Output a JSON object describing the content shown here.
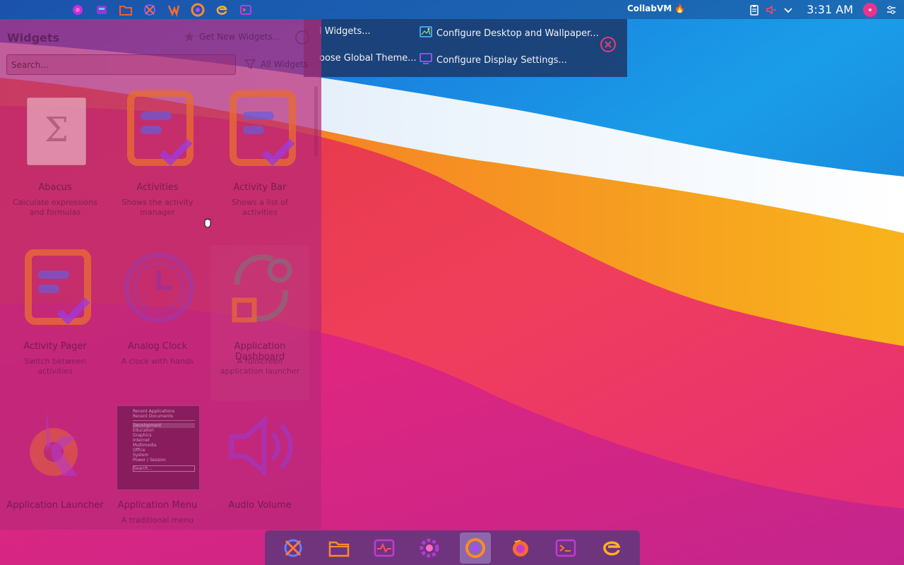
{
  "top_panel": {
    "title": "CollabVM",
    "title_suffix": "🔥",
    "clock": "3:31 AM",
    "launchers": [
      "settings-gear-icon",
      "network-icon",
      "folder-icon",
      "crossed-globe-icon",
      "flame-browser-icon",
      "chrome-icon",
      "edge-icon",
      "terminal-icon"
    ],
    "tray": [
      "clipboard-icon",
      "volume-muted-icon",
      "chevron-down-icon"
    ]
  },
  "toolbox": {
    "items": [
      {
        "label": "l Widgets...",
        "icon": "none"
      },
      {
        "label": "Configure Desktop and Wallpaper...",
        "icon": "wallpaper-icon"
      },
      {
        "label": "oose Global Theme...",
        "icon": "none"
      },
      {
        "label": "Configure Display Settings...",
        "icon": "monitor-icon"
      }
    ]
  },
  "widgets": {
    "title": "Widgets",
    "get_new": "Get New Widgets...",
    "search_placeholder": "Search...",
    "filter": "All Widgets",
    "items": [
      {
        "name": "Abacus",
        "desc": "Calculate expressions and formulas"
      },
      {
        "name": "Activities",
        "desc": "Shows the activity manager"
      },
      {
        "name": "Activity Bar",
        "desc": "Shows a list of activities"
      },
      {
        "name": "Activity Pager",
        "desc": "Switch between activities"
      },
      {
        "name": "Analog Clock",
        "desc": "A clock with hands"
      },
      {
        "name": "Application Dashboard",
        "desc": "A fullscreen application launcher"
      },
      {
        "name": "Application Launcher",
        "desc": ""
      },
      {
        "name": "Application Menu",
        "desc": "A traditional menu"
      },
      {
        "name": "Audio Volume",
        "desc": ""
      }
    ],
    "menu_preview_lines": [
      "Recent Applications",
      "Recent Documents",
      "Development",
      "Education",
      "Graphics",
      "Internet",
      "Multimedia",
      "Office",
      "System",
      "Power / Session",
      "Search..."
    ]
  },
  "dock": {
    "items": [
      "crossed-globe-icon",
      "folder-icon",
      "system-monitor-icon",
      "settings-gear-icon",
      "chrome-icon",
      "firefox-icon",
      "terminal-icon",
      "edge-icon"
    ],
    "active_index": 4
  },
  "colors": {
    "accent": "#e8348b",
    "orange": "#f39a1b",
    "purple": "#8a2be2"
  }
}
